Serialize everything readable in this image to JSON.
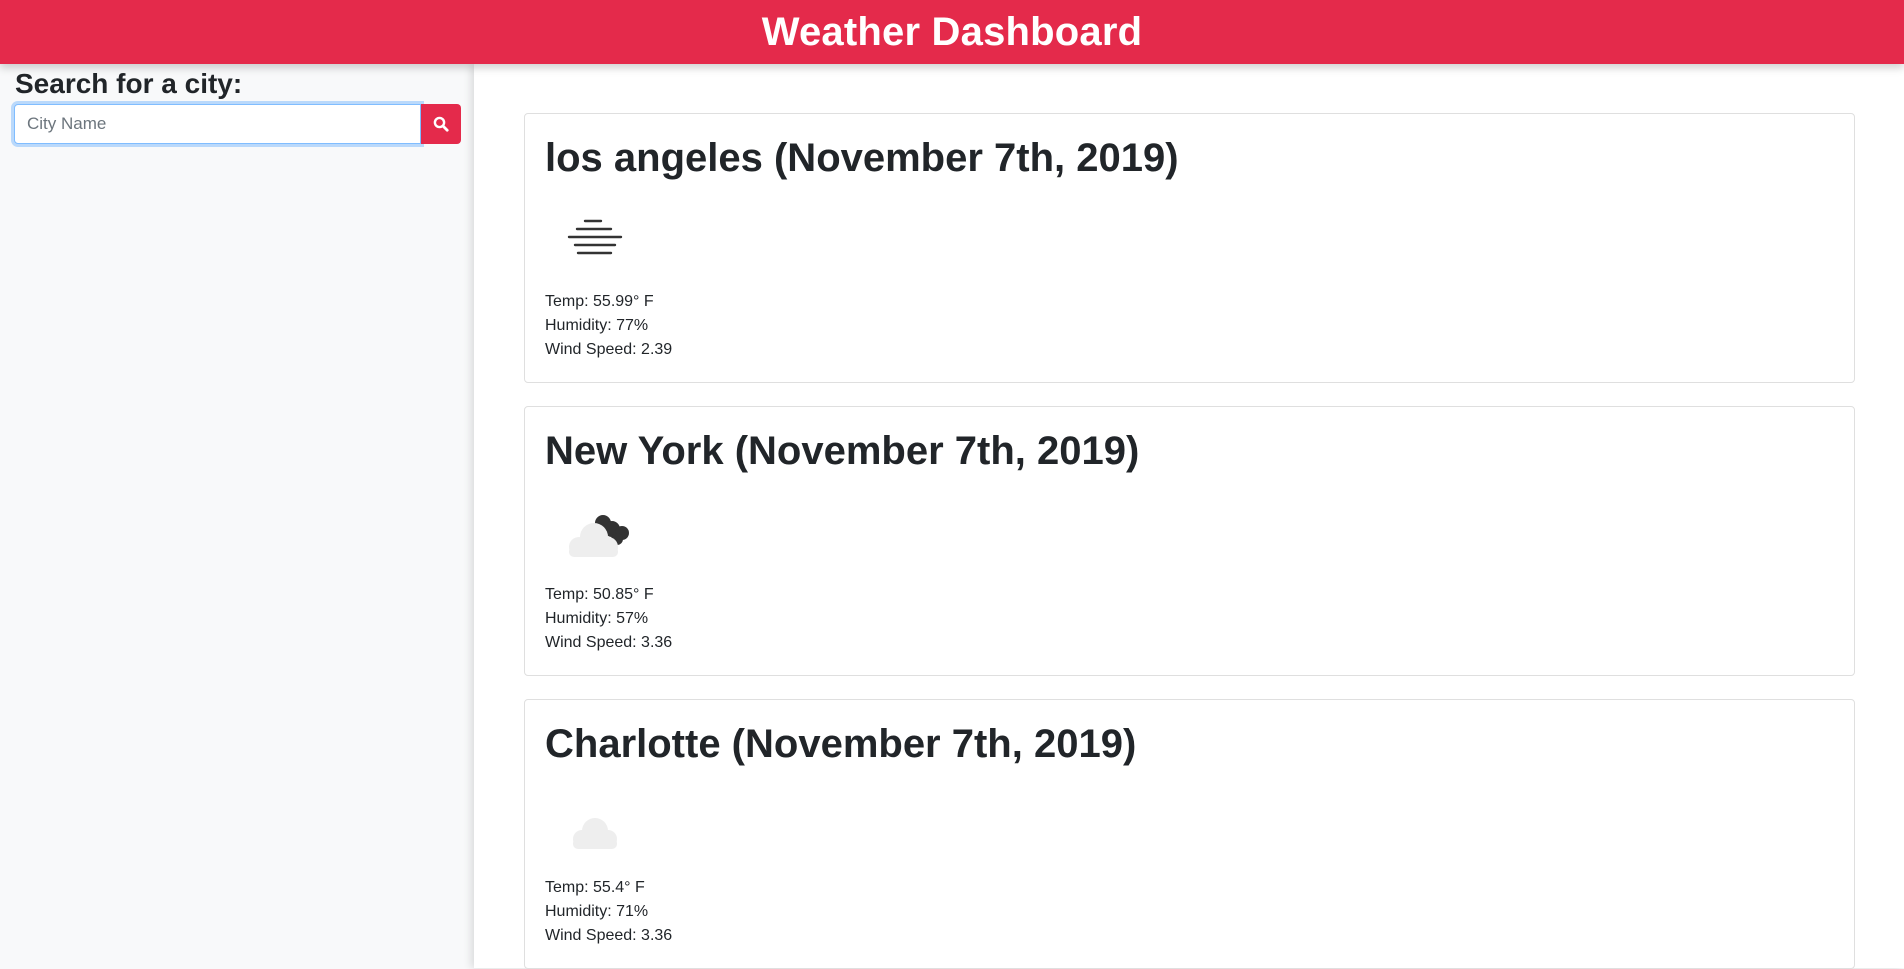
{
  "header": {
    "title": "Weather Dashboard"
  },
  "sidebar": {
    "search_label": "Search for a city:",
    "search_placeholder": "City Name",
    "search_button_icon": "search-icon"
  },
  "colors": {
    "brand": "#e42a4b",
    "focus": "#80bdff"
  },
  "cards": [
    {
      "title": "los angeles (November 7th, 2019)",
      "icon": "mist-icon",
      "temp": "Temp: 55.99° F",
      "humidity": "Humidity: 77%",
      "wind": "Wind Speed: 2.39"
    },
    {
      "title": "New York (November 7th, 2019)",
      "icon": "partly-cloudy-night-icon",
      "temp": "Temp: 50.85° F",
      "humidity": "Humidity: 57%",
      "wind": "Wind Speed: 3.36"
    },
    {
      "title": "Charlotte (November 7th, 2019)",
      "icon": "cloud-icon",
      "temp": "Temp: 55.4° F",
      "humidity": "Humidity: 71%",
      "wind": "Wind Speed: 3.36"
    }
  ]
}
